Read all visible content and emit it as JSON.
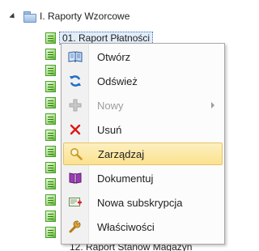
{
  "tree": {
    "root": {
      "label": "I. Raporty Wzorcowe",
      "icon": "folder-icon",
      "expanded": true
    },
    "selected_child": {
      "label": "01. Raport Płatności",
      "icon": "report-icon"
    },
    "hidden_child_partial": {
      "label": "12. Raport Stanów Magazyn"
    }
  },
  "context_menu": {
    "items": [
      {
        "label": "Otwórz",
        "icon": "open-book-icon",
        "enabled": true,
        "highlighted": false,
        "has_submenu": false
      },
      {
        "label": "Odśwież",
        "icon": "refresh-icon",
        "enabled": true,
        "highlighted": false,
        "has_submenu": false
      },
      {
        "label": "Nowy",
        "icon": "plus-icon",
        "enabled": false,
        "highlighted": false,
        "has_submenu": true
      },
      {
        "label": "Usuń",
        "icon": "delete-x-icon",
        "enabled": true,
        "highlighted": false,
        "has_submenu": false
      },
      {
        "label": "Zarządzaj",
        "icon": "magnifier-icon",
        "enabled": true,
        "highlighted": true,
        "has_submenu": false
      },
      {
        "label": "Dokumentuj",
        "icon": "document-book-icon",
        "enabled": true,
        "highlighted": false,
        "has_submenu": false
      },
      {
        "label": "Nowa subskrypcja",
        "icon": "subscription-icon",
        "enabled": true,
        "highlighted": false,
        "has_submenu": false
      },
      {
        "label": "Właściwości",
        "icon": "wrench-icon",
        "enabled": true,
        "highlighted": false,
        "has_submenu": false
      }
    ]
  },
  "colors": {
    "menu_highlight": "#fbe28f",
    "menu_highlight_border": "#e5c365",
    "disabled_text": "#9c9c9c",
    "report_icon_green": "#58b335",
    "folder_blue": "#9ebfe6"
  }
}
